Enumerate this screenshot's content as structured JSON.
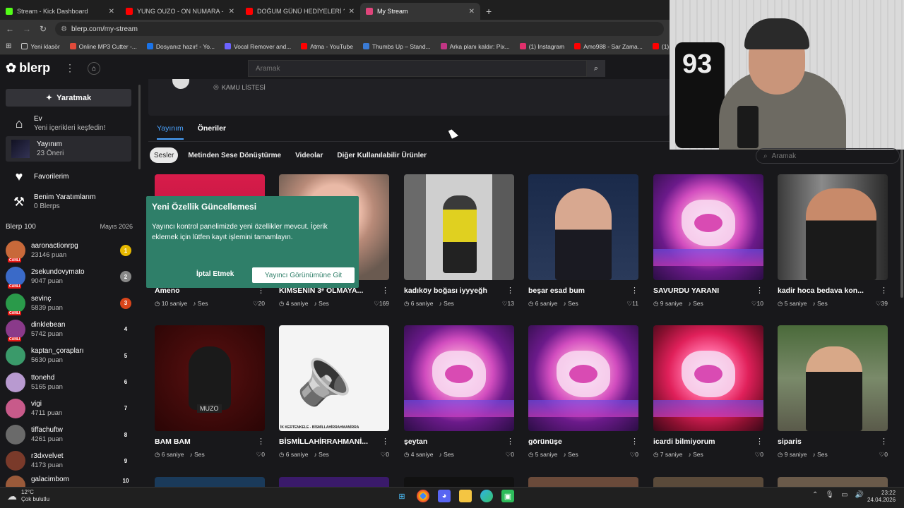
{
  "browser": {
    "tabs": [
      {
        "label": "Stream - Kick Dashboard",
        "color": "#53fc18"
      },
      {
        "label": "YUNG OUZO - ON NUMARA -",
        "color": "#ff0000"
      },
      {
        "label": "DOĞUM GÜNÜ HEDİYELERİ ?!",
        "color": "#ff0000"
      },
      {
        "label": "My Stream",
        "color": "#e0457b"
      }
    ],
    "new_tab": "+",
    "url": "blerp.com/my-stream",
    "bookmarks": [
      "Yeni klasör",
      "Online MP3 Cutter -...",
      "Dosyanız hazır! - Yo...",
      "Vocal Remover and...",
      "Atma - YouTube",
      "Thumbs Up – Stand...",
      "Arka planı kaldır: Pix...",
      "(1) Instagram",
      "Amo988 - Sar Zama...",
      "(1) Aysel Aydoğ"
    ]
  },
  "header": {
    "logo": "blerp",
    "search_placeholder": "Aramak"
  },
  "sidebar": {
    "create_label": "Yaratmak",
    "nav": [
      {
        "title": "Ev",
        "sub": "Yeni içerikleri keşfedin!",
        "icon": "home-icon"
      },
      {
        "title": "Yayınım",
        "sub": "23 Öneri",
        "icon": "stream-thumbnail"
      },
      {
        "title": "Favorilerim",
        "sub": "",
        "icon": "heart-icon"
      },
      {
        "title": "Benim Yaratımlarım",
        "sub": "0 Blerps",
        "icon": "hammer-icon"
      }
    ],
    "leaderboard_title": "Blerp 100",
    "leaderboard_date": "Mayıs 2026",
    "live_badge": "CANLI",
    "leaderboard": [
      {
        "name": "aaronactionrpg",
        "points": "23146 puan",
        "rank": "1",
        "badge": "#e6b800",
        "live": true,
        "av": "#c8693a"
      },
      {
        "name": "2sekundovymato",
        "points": "9047 puan",
        "rank": "2",
        "badge": "#888",
        "live": true,
        "av": "#3a6ac8"
      },
      {
        "name": "sevinç",
        "points": "5839 puan",
        "rank": "3",
        "badge": "#d9451b",
        "live": true,
        "av": "#2a9a4a"
      },
      {
        "name": "dinklebean",
        "points": "5742 puan",
        "rank": "4",
        "badge": "",
        "live": true,
        "av": "#8a3a8a"
      },
      {
        "name": "kaptan_çorapları",
        "points": "5630 puan",
        "rank": "5",
        "badge": "",
        "live": false,
        "av": "#3a9a6a"
      },
      {
        "name": "ttonehd",
        "points": "5165 puan",
        "rank": "6",
        "badge": "",
        "live": false,
        "av": "#b89ad0"
      },
      {
        "name": "vigi",
        "points": "4711 puan",
        "rank": "7",
        "badge": "",
        "live": false,
        "av": "#c85a8a"
      },
      {
        "name": "tiffachuftw",
        "points": "4261 puan",
        "rank": "8",
        "badge": "",
        "live": false,
        "av": "#6a6a6a"
      },
      {
        "name": "r3dxvelvet",
        "points": "4173 puan",
        "rank": "9",
        "badge": "",
        "live": false,
        "av": "#7a3a2a"
      },
      {
        "name": "galacimbom",
        "points": "",
        "rank": "10",
        "badge": "",
        "live": false,
        "av": "#9a5a3a"
      }
    ]
  },
  "main": {
    "list_type": "KAMU LİSTESİ",
    "tabs": [
      "Yayınım",
      "Öneriler"
    ],
    "filters": [
      "Sesler",
      "Metinden Sese Dönüştürme",
      "Videolar",
      "Diğer Kullanılabilir Ürünler"
    ],
    "search_placeholder": "Aramak",
    "cards": [
      {
        "title": "Ameno",
        "dur": "10 saniye",
        "type": "Ses",
        "likes": "20",
        "thumb": "red"
      },
      {
        "title": "KİMSENİN 3ᵉ OLMAYA...",
        "dur": "4 saniye",
        "type": "Ses",
        "likes": "169",
        "thumb": "face"
      },
      {
        "title": "kadıköy boğası iyyyeğh",
        "dur": "6 saniye",
        "type": "Ses",
        "likes": "13",
        "thumb": "man-yellow"
      },
      {
        "title": "beşar esad bum",
        "dur": "6 saniye",
        "type": "Ses",
        "likes": "11",
        "thumb": "suit"
      },
      {
        "title": "SAVURDU YARANI",
        "dur": "9 saniye",
        "type": "Ses",
        "likes": "10",
        "thumb": "grad"
      },
      {
        "title": "kadir hoca bedava kon...",
        "dur": "5 saniye",
        "type": "Ses",
        "likes": "39",
        "thumb": "gym"
      },
      {
        "title": "BAM BAM",
        "dur": "6 saniye",
        "type": "Ses",
        "likes": "0",
        "thumb": "muzo"
      },
      {
        "title": "BİSMİLLAHİRRAHMANİ...",
        "dur": "6 saniye",
        "type": "Ses",
        "likes": "0",
        "thumb": "speaker"
      },
      {
        "title": "şeytan",
        "dur": "4 saniye",
        "type": "Ses",
        "likes": "0",
        "thumb": "grad"
      },
      {
        "title": "görünüşe",
        "dur": "5 saniye",
        "type": "Ses",
        "likes": "0",
        "thumb": "grad"
      },
      {
        "title": "icardi bilmiyorum",
        "dur": "7 saniye",
        "type": "Ses",
        "likes": "0",
        "thumb": "grad-red"
      },
      {
        "title": "siparis",
        "dur": "9 saniye",
        "type": "Ses",
        "likes": "0",
        "thumb": "tree"
      }
    ],
    "muzo_text": "MUZO",
    "speaker_caption": "İK KERTENKELE - BİSMİLLAHİRRAHMANİRRA"
  },
  "modal": {
    "title": "Yeni Özellik Güncellemesi",
    "body": "Yayıncı kontrol panelimizde yeni özellikler mevcut. İçerik eklemek için lütfen kayıt işlemini tamamlayın.",
    "cancel": "İptal Etmek",
    "go": "Yayıncı Görünümüne Git"
  },
  "webcam": {
    "jersey_number": "93"
  },
  "taskbar": {
    "temp": "12°C",
    "weather": "Çok bulutlu",
    "time": "23:22",
    "date": "24.04.2026"
  }
}
